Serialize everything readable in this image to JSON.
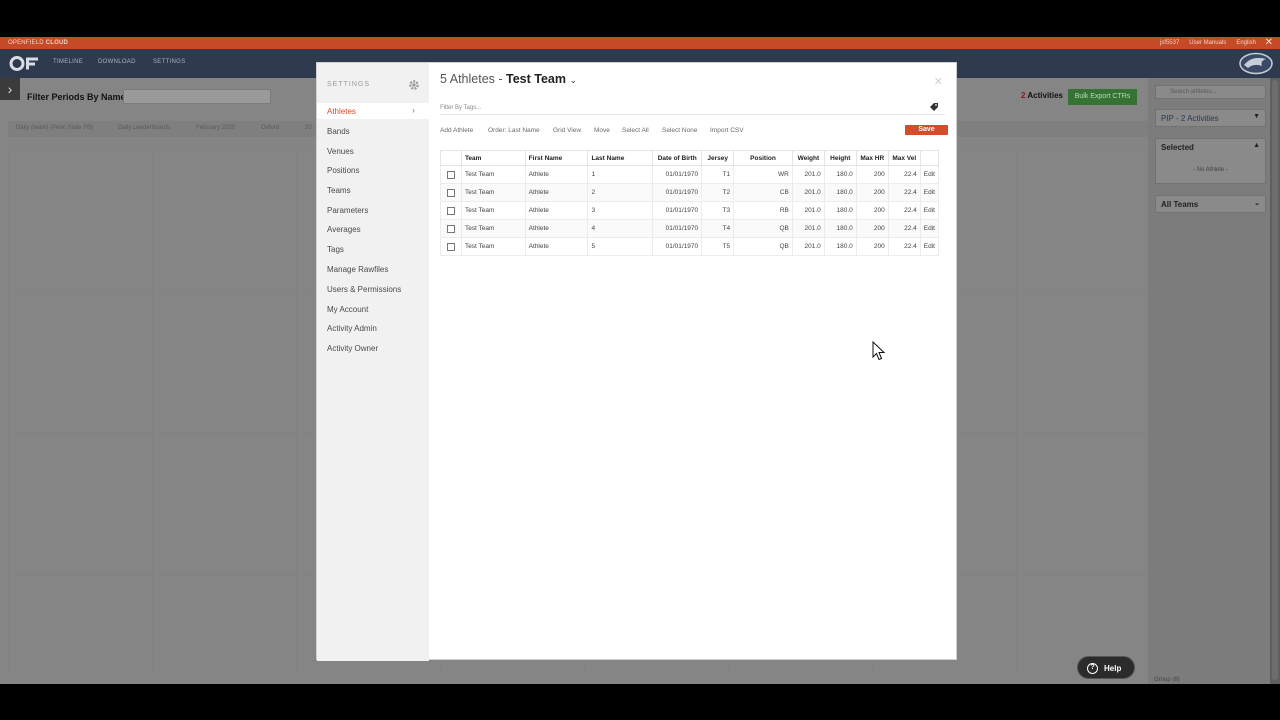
{
  "topbar": {
    "brand_a": "OPENFIELD",
    "brand_b": "CLOUD",
    "user": "jsf5537",
    "manuals": "User Manuals",
    "language": "English",
    "close": "✕"
  },
  "nav": {
    "items": [
      "TIMELINE",
      "DOWNLOAD",
      "SETTINGS"
    ]
  },
  "background": {
    "filter_title": "Filter Periods By Name",
    "tabs": [
      "Daily (team) (Penn State FB)",
      "Daily Leaderboards",
      "February 2020",
      "Oxford",
      "20"
    ],
    "activities_count": "2",
    "activities_label": "Activities",
    "bulk_export": "Bulk Export CTRs"
  },
  "rightpanel": {
    "search_placeholder": "Search athletes...",
    "pip": "PIP - 2 Activities",
    "selected": "Selected",
    "no_athlete": "- No Athlete -",
    "all_teams": "All Teams",
    "group": "Group (6)"
  },
  "modal": {
    "settings_label": "SETTINGS",
    "menu": [
      "Athletes",
      "Bands",
      "Venues",
      "Positions",
      "Teams",
      "Parameters",
      "Averages",
      "Tags",
      "Manage Rawfiles",
      "Users & Permissions",
      "My Account",
      "Activity Admin",
      "Activity Owner"
    ],
    "title_count": "5 Athletes - ",
    "title_team": "Test Team",
    "title_chevron": "⌄",
    "close": "✕",
    "filter_placeholder": "Filter By Tags...",
    "toolbar": {
      "add": "Add Athlete",
      "order": "Order: Last Name",
      "grid": "Grid View",
      "move": "Move",
      "select_all": "Select All",
      "select_none": "Select None",
      "import": "Import CSV",
      "save": "Save"
    },
    "table": {
      "headers": [
        "Team",
        "First Name",
        "Last Name",
        "Date of Birth",
        "Jersey",
        "Position",
        "Weight",
        "Height",
        "Max HR",
        "Max Vel"
      ],
      "edit_label": "Edit",
      "rows": [
        [
          "Test Team",
          "Athlete",
          "1",
          "01/01/1970",
          "T1",
          "WR",
          "201.0",
          "180.0",
          "200",
          "22.4"
        ],
        [
          "Test Team",
          "Athlete",
          "2",
          "01/01/1970",
          "T2",
          "CB",
          "201.0",
          "180.0",
          "200",
          "22.4"
        ],
        [
          "Test Team",
          "Athlete",
          "3",
          "01/01/1970",
          "T3",
          "RB",
          "201.0",
          "180.0",
          "200",
          "22.4"
        ],
        [
          "Test Team",
          "Athlete",
          "4",
          "01/01/1970",
          "T4",
          "QB",
          "201.0",
          "180.0",
          "200",
          "22.4"
        ],
        [
          "Test Team",
          "Athlete",
          "5",
          "01/01/1970",
          "T5",
          "QB",
          "201.0",
          "180.0",
          "200",
          "22.4"
        ]
      ]
    }
  },
  "help": {
    "label": "Help",
    "icon_glyph": "?"
  }
}
